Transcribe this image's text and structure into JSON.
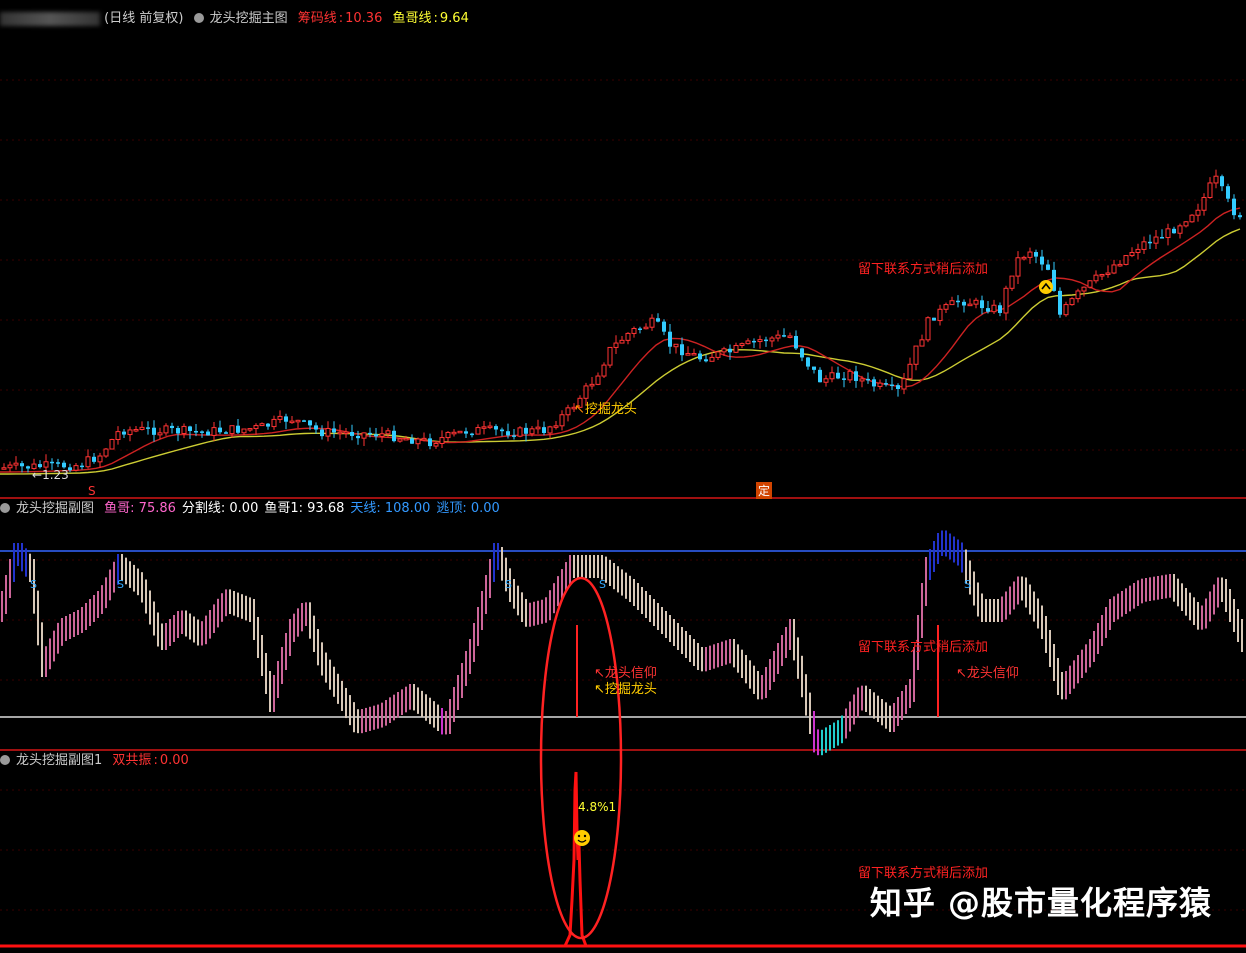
{
  "main_panel": {
    "period_label": "(日线 前复权)",
    "indicator_name": "龙头挖掘主图",
    "value1_label": "筹码线",
    "value1": "10.36",
    "value2_label": "鱼哥线",
    "value2": "9.64",
    "low_price": "1.23",
    "signal_label": "挖掘龙头",
    "contact_note": "留下联系方式稍后添加",
    "s_marker": "S",
    "ding_marker": "定"
  },
  "sub_panel1": {
    "indicator_name": "龙头挖掘副图",
    "fields": [
      {
        "label": "鱼哥",
        "value": "75.86",
        "color": "#ff66cc"
      },
      {
        "label": "分割线",
        "value": "0.00",
        "color": "#ffffff"
      },
      {
        "label": "鱼哥1",
        "value": "93.68",
        "color": "#ffffff"
      },
      {
        "label": "天线",
        "value": "108.00",
        "color": "#3399ff"
      },
      {
        "label": "逃顶",
        "value": "0.00",
        "color": "#3399ff"
      }
    ],
    "signal_belief": "龙头信仰",
    "signal_dig": "挖掘龙头",
    "contact_note": "留下联系方式稍后添加",
    "s_marker": "S"
  },
  "sub_panel2": {
    "indicator_name": "龙头挖掘副图1",
    "field_label": "双共振",
    "field_value": "0.00",
    "peak_label": "4.8%1",
    "contact_note": "留下联系方式稍后添加"
  },
  "watermark": "知乎 @股市量化程序猿",
  "colors": {
    "up": "#ff3333",
    "down": "#33ccff",
    "ma_long": "#cccc33",
    "ma_short": "#cc2222",
    "ceiling": "#3366ff",
    "panel_border": "#a01010",
    "highlight": "#ff2222"
  }
}
